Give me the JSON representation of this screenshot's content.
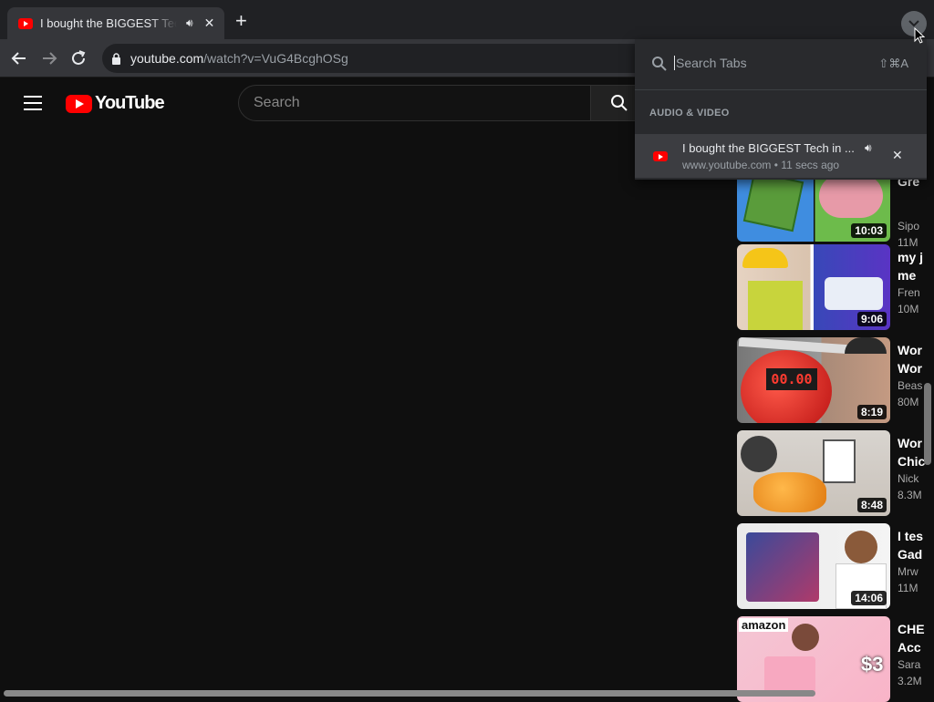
{
  "browser": {
    "tab_title": "I bought the BIGGEST Tech in the World",
    "tab_audio_icon": "speaker-icon",
    "tab_close": "✕",
    "new_tab": "+",
    "url_host": "youtube.com",
    "url_path": "/watch?v=VuG4BcghOSg"
  },
  "youtube": {
    "logo_text": "YouTube",
    "search_placeholder": "Search"
  },
  "tab_search_panel": {
    "placeholder": "Search Tabs",
    "shortcut": "⇧⌘A",
    "section_label": "AUDIO & VIDEO",
    "item": {
      "title": "I bought the BIGGEST Tech in ...",
      "domain": "www.youtube.com",
      "time": "11 secs ago",
      "separator": "•",
      "close": "✕"
    }
  },
  "related_videos": [
    {
      "title": "Gre",
      "channel": "Sipo",
      "views": "11M",
      "duration": "10:03"
    },
    {
      "title": "my j\nme",
      "channel": "Fren",
      "views": "10M",
      "duration": "9:06"
    },
    {
      "title": "Wor\nWor",
      "channel": "Beas",
      "views": "80M",
      "duration": "8:19",
      "thumb_text": "00.00"
    },
    {
      "title": "Wor\nChic",
      "channel": "Nick",
      "views": "8.3M",
      "duration": "8:48"
    },
    {
      "title": "I tes\nGad",
      "channel": "Mrw",
      "views": "11M",
      "duration": "14:06"
    },
    {
      "title": "CHE\nAcc",
      "channel": "Sara",
      "views": "3.2M",
      "duration": "",
      "thumb_text": "amazon",
      "thumb_price": "$3"
    }
  ]
}
